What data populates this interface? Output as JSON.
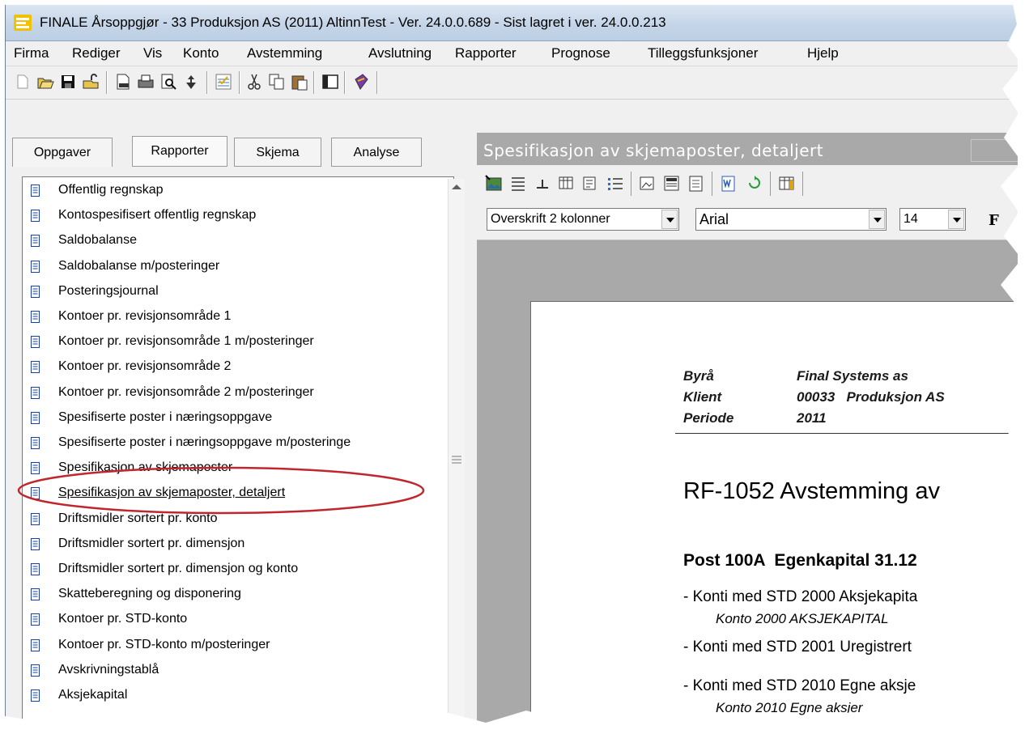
{
  "window": {
    "title": "FINALE Årsoppgjør - 33 Produksjon AS (2011) AltinnTest - Ver. 24.0.0.689 - Sist lagret i ver. 24.0.0.213",
    "icon": "finale-app-icon"
  },
  "menu": [
    "Firma",
    "Rediger",
    "Vis",
    "Konto",
    "Avstemming",
    "Avslutning",
    "Rapporter",
    "Prognose",
    "Tilleggsfunksjoner",
    "Hjelp"
  ],
  "toolbar": {
    "icons": [
      "new-icon",
      "open-icon",
      "save-icon",
      "unlock-icon",
      "print-preview-icon",
      "print-icon",
      "find-icon",
      "report-icon",
      "checklist-icon",
      "cut-icon",
      "copy-icon",
      "paste-icon",
      "panel-icon",
      "book-icon"
    ]
  },
  "left_panel": {
    "tabs": [
      "Oppgaver",
      "Rapporter",
      "Skjema",
      "Analyse"
    ],
    "active_tab": "Rapporter",
    "reports": [
      "Offentlig regnskap",
      "Kontospesifisert offentlig regnskap",
      "Saldobalanse",
      "Saldobalanse m/posteringer",
      "Posteringsjournal",
      "Kontoer pr. revisjonsområde 1",
      "Kontoer pr. revisjonsområde 1 m/posteringer",
      "Kontoer pr. revisjonsområde 2",
      "Kontoer pr. revisjonsområde 2 m/posteringer",
      "Spesifiserte poster i næringsoppgave",
      "Spesifiserte poster i næringsoppgave m/posteringe",
      "Spesifikasjon av skjemaposter",
      "Spesifikasjon av skjemaposter, detaljert",
      "Driftsmidler sortert pr. konto",
      "Driftsmidler sortert pr. dimensjon",
      "Driftsmidler sortert pr. dimensjon og konto",
      "Skatteberegning og disponering",
      "Kontoer pr. STD-konto",
      "Kontoer pr. STD-konto m/posteringer",
      "Avskrivningstablå",
      "Aksjekapital"
    ],
    "selected_report": "Spesifikasjon av skjemaposter, detaljert",
    "highlight_color": "#c0272d"
  },
  "right_panel": {
    "title": "Spesifikasjon av skjemaposter, detaljert",
    "toolbar_icons": [
      "insert-image-icon",
      "align-icon",
      "tab-stop-icon",
      "table-icon",
      "list-edit-icon",
      "bullets-icon",
      "image-edit-icon",
      "layout-icon",
      "page-icon",
      "word-export-icon",
      "refresh-icon",
      "columns-icon"
    ],
    "style_combo": "Overskrift 2 kolonner",
    "font_combo": "Arial",
    "size_combo": "14",
    "document": {
      "meta": [
        {
          "label": "Byrå",
          "value": "Final Systems as"
        },
        {
          "label": "Klient",
          "value": "00033   Produksjon AS"
        },
        {
          "label": "Periode",
          "value": "2011"
        }
      ],
      "heading": "RF-1052 Avstemming av",
      "post_heading": "Post 100A  Egenkapital 31.12",
      "lines": [
        {
          "text": "- Konti med STD 2000 Aksjekapita",
          "sub": "Konto 2000 AKSJEKAPITAL"
        },
        {
          "text": "- Konti med STD 2001 Uregistrert",
          "sub": ""
        },
        {
          "text": "- Konti med STD 2010 Egne aksje",
          "sub": "Konto 2010 Egne aksjer"
        }
      ]
    }
  }
}
